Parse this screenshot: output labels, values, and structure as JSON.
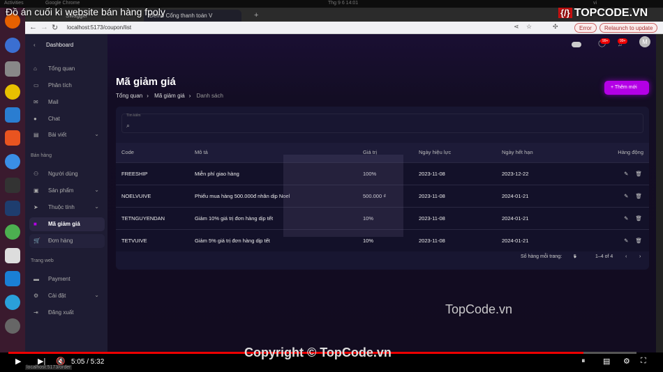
{
  "video": {
    "title": "Đồ án cuối kì website bán hàng fpoly",
    "time": "5:05 / 5:32",
    "progress_percent": 91.5,
    "watermark": "TopCode.vn",
    "copyright": "Copyright © TopCode.vn",
    "logo": "TOPCODE.VN"
  },
  "os": {
    "activities": "Activities",
    "app": "Google Chrome",
    "clock": "Thg 9 6  14:01",
    "lang": "vi"
  },
  "browser": {
    "tabs": [
      "Swagger",
      "Demo Cổng thanh toán V"
    ],
    "url": "localhost:5173/coupon/list",
    "error_label": "Error",
    "relaunch_label": "Relaunch to update",
    "status_url": "localhost:5173/order"
  },
  "header": {
    "chat_badge": "99+",
    "notif_badge": "99+",
    "avatar": "M"
  },
  "sidebar": {
    "back_label": "Dashboard",
    "items": [
      {
        "label": "Tổng quan",
        "icon": "⌂"
      },
      {
        "label": "Phân tích",
        "icon": "▭"
      },
      {
        "label": "Mail",
        "icon": "✉"
      },
      {
        "label": "Chat",
        "icon": "●"
      },
      {
        "label": "Bài viết",
        "icon": "▤"
      }
    ],
    "section_sales": "Bán hàng",
    "sales": [
      {
        "label": "Người dùng",
        "icon": "⚇"
      },
      {
        "label": "Sản phẩm",
        "icon": "▣"
      },
      {
        "label": "Thuộc tính",
        "icon": "➤"
      },
      {
        "label": "Mã giảm giá",
        "icon": "■"
      },
      {
        "label": "Đơn hàng",
        "icon": "🛒"
      }
    ],
    "section_web": "Trang web",
    "web": [
      {
        "label": "Payment",
        "icon": "▬"
      },
      {
        "label": "Cài đặt",
        "icon": "⚙"
      },
      {
        "label": "Đăng xuất",
        "icon": "⇥"
      }
    ]
  },
  "page": {
    "title": "Mã giảm giá",
    "breadcrumb": [
      "Tổng quan",
      "Mã giảm giá",
      "Danh sách"
    ],
    "add_button": "+  Thêm mới",
    "search_label": "Tìm kiếm"
  },
  "table": {
    "headers": [
      "Code",
      "Mô tả",
      "Giá trị",
      "Ngày hiệu lực",
      "Ngày hết hạn",
      "Hàng động"
    ],
    "rows": [
      [
        "FREESHIP",
        "Miễn phí giao hàng",
        "100%",
        "2023-11-08",
        "2023-12-22"
      ],
      [
        "NOELVUIVE",
        "Phiếu mua hàng 500.000đ nhân dịp Noel",
        "500.000 ₫",
        "2023-11-08",
        "2024-01-21"
      ],
      [
        "TETNGUYENDAN",
        "Giảm 10% giá trị đơn hàng dịp tết",
        "10%",
        "2023-11-08",
        "2024-01-21"
      ],
      [
        "TETVUIVE",
        "Giảm 5% giá trị đơn hàng dịp tết",
        "10%",
        "2023-11-08",
        "2024-01-21"
      ]
    ]
  },
  "pager": {
    "rows_label": "Số hàng mỗi trang:",
    "rows_value": "5",
    "range": "1–4 of 4"
  },
  "colors": {
    "accent": "#b400e6",
    "sidebar": "#1e1c33",
    "progress": "#e00000"
  }
}
